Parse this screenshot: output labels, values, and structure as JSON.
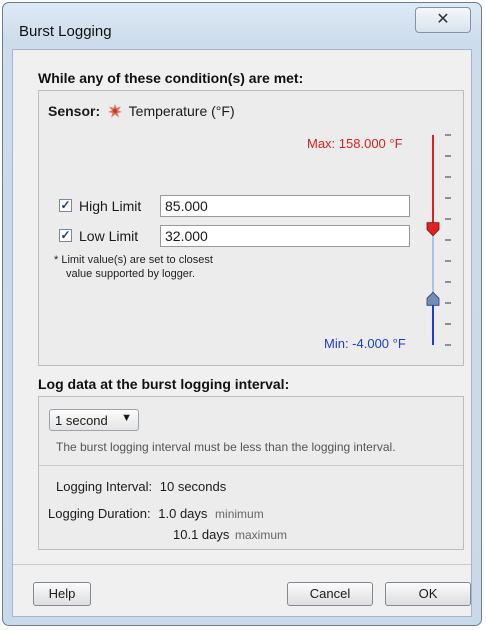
{
  "window": {
    "title": "Burst Logging"
  },
  "conditions": {
    "header": "While any of these condition(s) are met:",
    "sensor_label": "Sensor:",
    "sensor_icon": "temperature-sensor-icon",
    "sensor_name": "Temperature (°F)",
    "high_limit": {
      "label": "High Limit",
      "checked": true,
      "value": "85.000"
    },
    "low_limit": {
      "label": "Low Limit",
      "checked": true,
      "value": "32.000"
    },
    "note_line1": "*  Limit value(s) are set to closest",
    "note_line2": "value supported by logger.",
    "max_label": "Max: 158.000 °F",
    "min_label": "Min: -4.000 °F",
    "slider": {
      "max": 158.0,
      "min": -4.0,
      "high": 85.0,
      "low": 32.0,
      "high_color": "#e02020",
      "low_color": "#1f3bd8"
    }
  },
  "burst": {
    "header": "Log data at the burst logging interval:",
    "interval_value": "1 second",
    "hint": "The burst logging interval must be less than the logging interval.",
    "logging_interval_label": "Logging Interval:",
    "logging_interval_value": "10 seconds",
    "logging_duration_label": "Logging Duration:",
    "duration_min_value": "1.0 days",
    "duration_min_word": "minimum",
    "duration_max_value": "10.1 days",
    "duration_max_word": "maximum"
  },
  "buttons": {
    "help": "Help",
    "cancel": "Cancel",
    "ok": "OK",
    "close": "✕"
  }
}
